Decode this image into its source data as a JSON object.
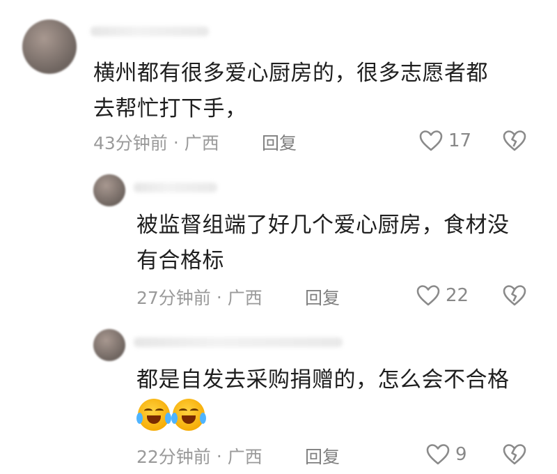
{
  "comments": [
    {
      "text": "横州都有很多爱心厨房的，很多志愿者都\n去帮忙打下手，",
      "time": "43分钟前",
      "sep": "·",
      "location": "广西",
      "reply_label": "回复",
      "likes": "17"
    },
    {
      "text": "被监督组端了好几个爱心厨房，食材没\n有合格标",
      "time": "27分钟前",
      "sep": "·",
      "location": "广西",
      "reply_label": "回复",
      "likes": "22"
    },
    {
      "text": "都是自发去采购捐赠的，怎么会不合格",
      "emojis": [
        "crying-laughing-emoji",
        "crying-laughing-emoji"
      ],
      "time": "22分钟前",
      "sep": "·",
      "location": "广西",
      "reply_label": "回复",
      "likes": "9"
    }
  ],
  "colors": {
    "text": "#1e1e1e",
    "meta": "#9a9a9a",
    "icon": "#8a8a8a"
  }
}
